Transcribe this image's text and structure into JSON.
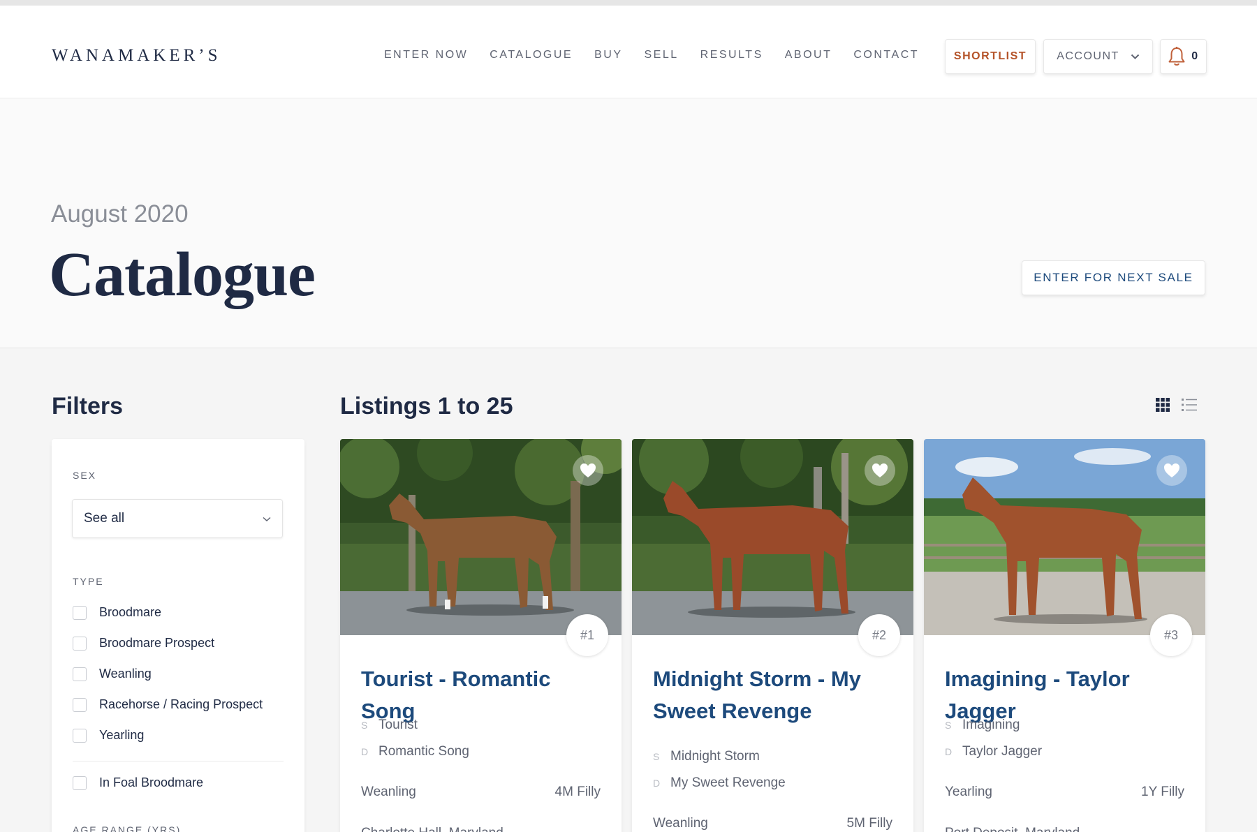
{
  "header": {
    "logo": "WANAMAKER’S",
    "nav": [
      "ENTER NOW",
      "CATALOGUE",
      "BUY",
      "SELL",
      "RESULTS",
      "ABOUT",
      "CONTACT"
    ],
    "shortlist_label": "SHORTLIST",
    "account_label": "ACCOUNT",
    "notification_count": "0",
    "icons": {
      "account_chevron": "chevron-down-icon",
      "notifications": "bell-icon"
    },
    "colors": {
      "accent": "#b5542a",
      "link": "#1d4a7c",
      "ink": "#1f2a44"
    }
  },
  "hero": {
    "date": "August 2020",
    "title": "Catalogue",
    "enter_button": "ENTER FOR NEXT SALE"
  },
  "filters": {
    "heading": "Filters",
    "sex_label": "SEX",
    "sex_value": "See all",
    "type_label": "TYPE",
    "type_options": [
      "Broodmare",
      "Broodmare Prospect",
      "Weanling",
      "Racehorse / Racing Prospect",
      "Yearling"
    ],
    "in_foal_label": "In Foal Broodmare",
    "age_label": "AGE RANGE (YRS)"
  },
  "listings": {
    "heading": "Listings 1 to 25",
    "view_icons": [
      "grid-view-icon",
      "list-view-icon"
    ],
    "cards": [
      {
        "lot": "#1",
        "title": "Tourist - Romantic Song",
        "sire_key": "S",
        "sire": "Tourist",
        "dam_key": "D",
        "dam": "Romantic Song",
        "type": "Weanling",
        "age_sex": "4M Filly",
        "location": "Charlotte Hall, Maryland"
      },
      {
        "lot": "#2",
        "title": "Midnight Storm - My Sweet Revenge",
        "sire_key": "S",
        "sire": "Midnight Storm",
        "dam_key": "D",
        "dam": "My Sweet Revenge",
        "type": "Weanling",
        "age_sex": "5M Filly"
      },
      {
        "lot": "#3",
        "title": "Imagining - Taylor Jagger",
        "sire_key": "S",
        "sire": "Imagining",
        "dam_key": "D",
        "dam": "Taylor Jagger",
        "type": "Yearling",
        "age_sex": "1Y Filly",
        "location": "Port Deposit, Maryland"
      }
    ]
  }
}
